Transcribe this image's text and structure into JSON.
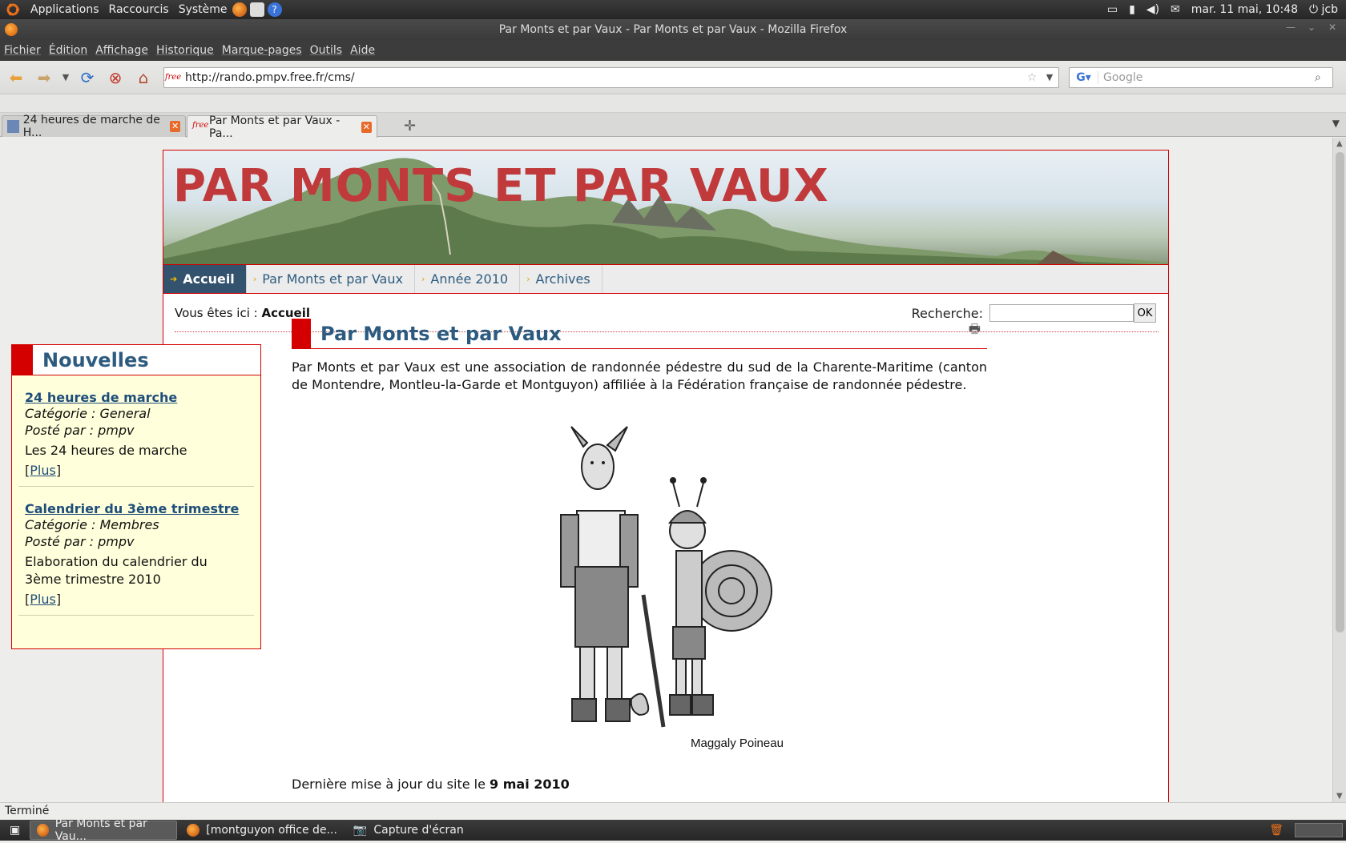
{
  "top_panel": {
    "menus": [
      "Applications",
      "Raccourcis",
      "Système"
    ],
    "datetime": "mar. 11 mai, 10:48",
    "user": "jcb"
  },
  "window": {
    "title": "Par Monts et par Vaux - Par Monts et par Vaux - Mozilla Firefox"
  },
  "menubar": [
    "Fichier",
    "Édition",
    "Affichage",
    "Historique",
    "Marque-pages",
    "Outils",
    "Aide"
  ],
  "navbar": {
    "url": "http://rando.pmpv.free.fr/cms/",
    "url_favicon": "free",
    "search_placeholder": "Google"
  },
  "tabs": [
    {
      "label": "24 heures de marche de H...",
      "active": false
    },
    {
      "label": "Par Monts et par Vaux - Pa...",
      "active": true
    }
  ],
  "page": {
    "site_title": "PAR MONTS ET PAR VAUX",
    "nav": [
      {
        "label": "Accueil",
        "active": true
      },
      {
        "label": "Par Monts et par Vaux",
        "active": false
      },
      {
        "label": "Année 2010",
        "active": false
      },
      {
        "label": "Archives",
        "active": false
      }
    ],
    "breadcrumb_prefix": "Vous êtes ici :",
    "breadcrumb_current": "Accueil",
    "search_label": "Recherche:",
    "search_button": "OK",
    "sidebar": {
      "title": "Nouvelles",
      "items": [
        {
          "title": "24 heures de marche",
          "category": "Catégorie : General",
          "author": "Posté par : pmpv",
          "summary": "Les 24 heures de marche",
          "more": "Plus"
        },
        {
          "title": "Calendrier du 3ème trimestre",
          "category": "Catégorie : Membres",
          "author": "Posté par : pmpv",
          "summary": "Elaboration du calendrier du 3ème trimestre 2010",
          "more": "Plus"
        }
      ]
    },
    "article": {
      "title": "Par Monts et par Vaux",
      "body": "Par Monts et par Vaux est une association de randonnée pédestre du sud de la Charente-Maritime (canton de Montendre, Montleu-la-Garde et Montguyon)  affiliée à la Fédération française de randonnée pédestre.",
      "image_caption": "Maggaly Poineau",
      "updated_prefix": "Dernière mise à jour du site le",
      "updated_date": "9 mai 2010"
    }
  },
  "status": "Terminé",
  "taskbar": [
    {
      "label": "Par Monts et par Vau...",
      "active": true
    },
    {
      "label": "[montguyon office de...",
      "active": false
    },
    {
      "label": "Capture d'écran",
      "active": false
    }
  ]
}
